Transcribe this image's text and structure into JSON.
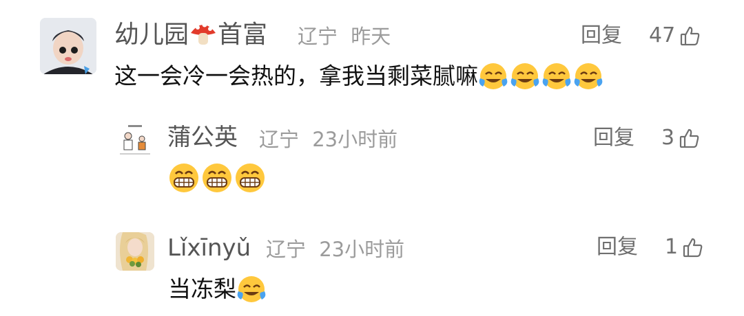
{
  "comments": [
    {
      "user": "幼儿园",
      "title": "首富",
      "location": "辽宁",
      "time": "昨天",
      "reply_label": "回复",
      "likes": "47",
      "text": "这一会冷一会热的，拿我当剩菜腻嘛",
      "emoji_name": "face-with-tears-of-joy",
      "emoji_count": 4
    },
    {
      "user": "蒲公英",
      "location": "辽宁",
      "time": "23小时前",
      "reply_label": "回复",
      "likes": "3",
      "emoji_name": "grinning-face",
      "emoji_count": 3
    },
    {
      "user": "Lǐxīnyǔ",
      "location": "辽宁",
      "time": "23小时前",
      "reply_label": "回复",
      "likes": "1",
      "text": "当冻梨",
      "emoji_name": "face-with-tears-of-joy",
      "emoji_count": 1
    }
  ],
  "colors": {
    "name": "#555555",
    "meta": "#9b9b9b",
    "body": "#111111",
    "emoji_yellow": "#ffc83d"
  }
}
